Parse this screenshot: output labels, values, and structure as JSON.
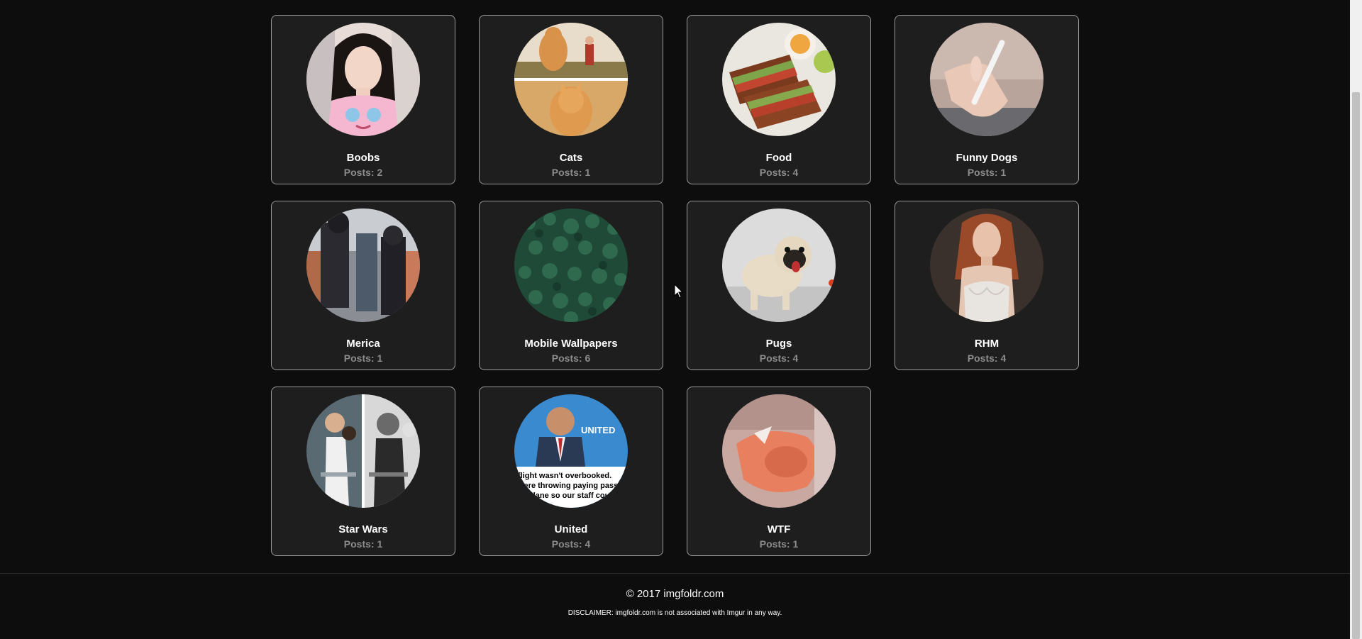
{
  "albums": [
    {
      "title": "Boobs",
      "posts": "Posts: 2",
      "thumb": "woman-portrait-thumbnail"
    },
    {
      "title": "Cats",
      "posts": "Posts: 1",
      "thumb": "cats-thumbnail"
    },
    {
      "title": "Food",
      "posts": "Posts: 4",
      "thumb": "sandwich-thumbnail"
    },
    {
      "title": "Funny Dogs",
      "posts": "Posts: 1",
      "thumb": "hand-pen-thumbnail"
    },
    {
      "title": "Merica",
      "posts": "Posts: 1",
      "thumb": "crowd-thumbnail"
    },
    {
      "title": "Mobile Wallpapers",
      "posts": "Posts: 6",
      "thumb": "forest-thumbnail"
    },
    {
      "title": "Pugs",
      "posts": "Posts: 4",
      "thumb": "pug-thumbnail"
    },
    {
      "title": "RHM",
      "posts": "Posts: 4",
      "thumb": "redhead-thumbnail"
    },
    {
      "title": "Star Wars",
      "posts": "Posts: 1",
      "thumb": "star-wars-thumbnail"
    },
    {
      "title": "United",
      "posts": "Posts: 4",
      "thumb": "united-meme-thumbnail"
    },
    {
      "title": "WTF",
      "posts": "Posts: 1",
      "thumb": "blurry-thumbnail"
    }
  ],
  "united_meme": {
    "logo_text": "UNITED",
    "line1": "flight wasn't overbooked.",
    "line2": "were throwing paying passen",
    "line3": "plane so our staff could"
  },
  "footer": {
    "copyright": "© 2017 imgfoldr.com",
    "disclaimer": "DISCLAIMER: imgfoldr.com is not associated with Imgur in any way."
  }
}
